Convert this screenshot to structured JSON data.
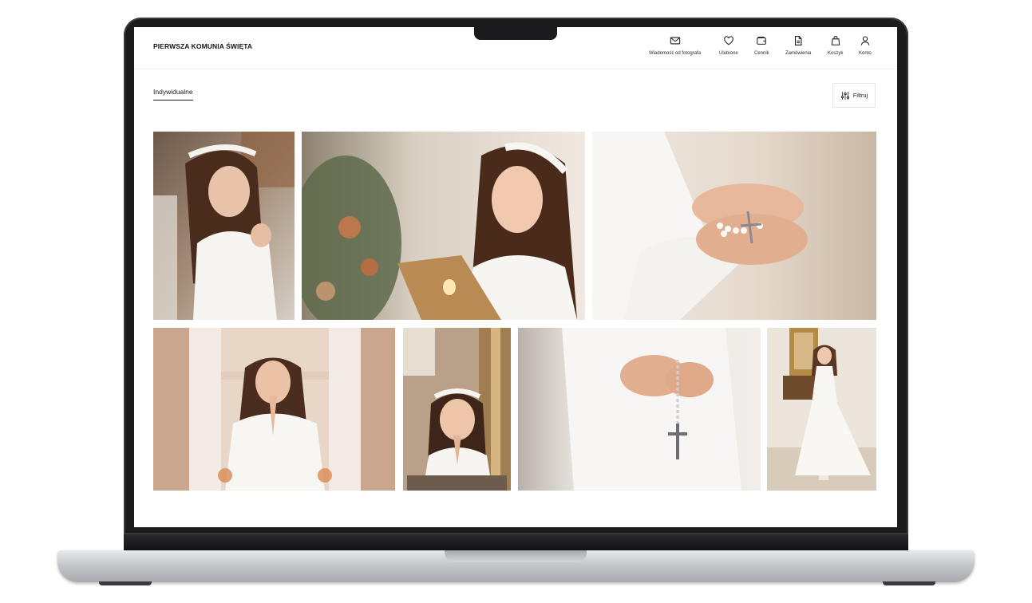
{
  "site": {
    "title": "PIERWSZA KOMUNIA ŚWIĘTA"
  },
  "nav": [
    {
      "label": "Wiadomość od fotografa",
      "icon": "envelope-icon"
    },
    {
      "label": "Ulubione",
      "icon": "heart-icon"
    },
    {
      "label": "Cennik",
      "icon": "wallet-icon"
    },
    {
      "label": "Zamówienia",
      "icon": "document-icon"
    },
    {
      "label": "Koszyk",
      "icon": "shopping-bag-icon"
    },
    {
      "label": "Konto",
      "icon": "user-icon"
    }
  ],
  "tabs": [
    {
      "label": "Indywidualne",
      "active": true
    }
  ],
  "filter": {
    "label": "Filtruj",
    "icon": "sliders-icon"
  },
  "gallery": {
    "photos": [
      {
        "subject": "girl-praying-with-rosary"
      },
      {
        "subject": "girl-looking-up-by-altar"
      },
      {
        "subject": "hands-holding-rosary"
      },
      {
        "subject": "girl-praying-hands-together"
      },
      {
        "subject": "girl-eyes-closed-praying"
      },
      {
        "subject": "hands-with-crucifix-rosary"
      },
      {
        "subject": "girl-full-length-white-dress"
      }
    ]
  },
  "colors": {
    "text": "#1a1a1a",
    "bezel": "#1b1b1d",
    "aluminium": "#c9cacd"
  }
}
